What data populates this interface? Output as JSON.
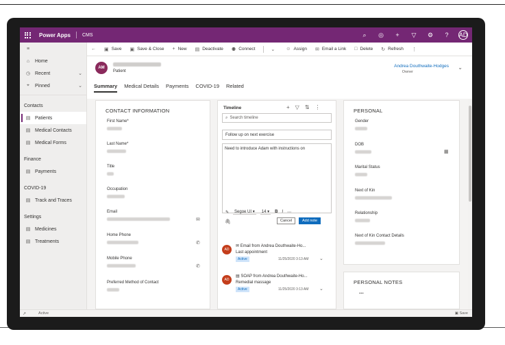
{
  "app": {
    "name": "Power Apps",
    "sub": "CMS",
    "user_initials": "AD"
  },
  "appbar_icons": [
    "search-icon",
    "target-icon",
    "plus-icon",
    "filter-icon",
    "gear-icon",
    "help-icon"
  ],
  "sidebar": {
    "items_top": [
      {
        "label": "Home",
        "icon": "home-icon"
      },
      {
        "label": "Recent",
        "icon": "clock-icon"
      },
      {
        "label": "Pinned",
        "icon": "pin-icon"
      }
    ],
    "groups": [
      {
        "title": "Contacts",
        "items": [
          {
            "label": "Patients",
            "icon": "person-icon"
          },
          {
            "label": "Medical Contacts",
            "icon": "contact-icon"
          },
          {
            "label": "Medical Forms",
            "icon": "form-icon"
          }
        ]
      },
      {
        "title": "Finance",
        "items": [
          {
            "label": "Payments",
            "icon": "payment-icon"
          }
        ]
      },
      {
        "title": "COVID-19",
        "items": [
          {
            "label": "Track and Traces",
            "icon": "track-icon"
          }
        ]
      },
      {
        "title": "Settings",
        "items": [
          {
            "label": "Medicines",
            "icon": "medicine-icon"
          },
          {
            "label": "Treatments",
            "icon": "treatment-icon"
          }
        ]
      }
    ]
  },
  "commands": {
    "save": "Save",
    "save_close": "Save & Close",
    "new": "New",
    "deactivate": "Deactivate",
    "connect": "Connect",
    "assign": "Assign",
    "email_link": "Email a Link",
    "delete": "Delete",
    "refresh": "Refresh"
  },
  "record": {
    "initials": "AM",
    "type": "Patient",
    "owner_name": "Andrea Douthwaite-Hodges",
    "owner_label": "Owner"
  },
  "tabs": [
    "Summary",
    "Medical Details",
    "Payments",
    "COVID-19",
    "Related"
  ],
  "contact": {
    "title": "CONTACT INFORMATION",
    "fields": [
      "First Name*",
      "Last Name*",
      "Title",
      "Occupation",
      "Email",
      "Home Phone",
      "Mobile Phone",
      "Preferred Method of Contact"
    ]
  },
  "timeline": {
    "title": "Timeline",
    "search_placeholder": "Search timeline",
    "subject": "Follow up on next exercise",
    "body": "Need to introduce Adam with instructions on",
    "font": "Segoe UI",
    "size": "14",
    "cancel": "Cancel",
    "add_note": "Add note",
    "entries": [
      {
        "initials": "AD",
        "title": "Email from Andrea Douthwaite-Ho...",
        "sub": "Last appointment",
        "status": "Active",
        "time": "11/25/2020 3:13 AM"
      },
      {
        "initials": "AD",
        "title": "SOAP from Andrea Douthwaite-Ho...",
        "sub": "Remedial massage",
        "status": "Active",
        "time": "11/25/2020 3:13 AM"
      }
    ]
  },
  "personal": {
    "title": "PERSONAL",
    "fields": [
      "Gender",
      "DOB",
      "Marital Status",
      "Next of Kin",
      "Relationship",
      "Next of Kin Contact Details"
    ]
  },
  "notes": {
    "title": "PERSONAL NOTES",
    "ellipsis": "..."
  },
  "status": {
    "state": "Active",
    "save": "Save"
  }
}
